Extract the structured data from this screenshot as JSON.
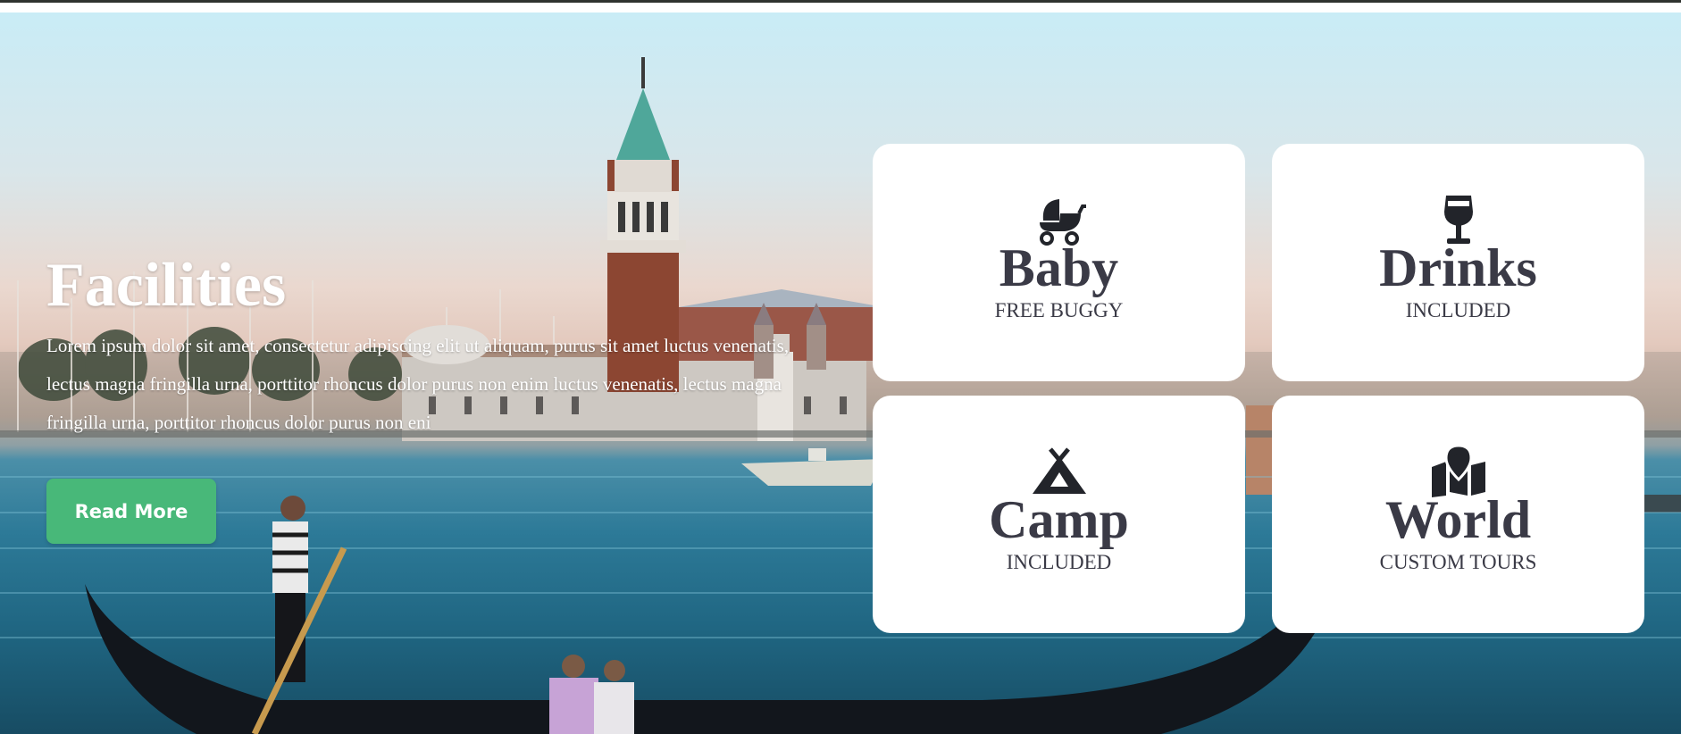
{
  "hero": {
    "title": "Facilities",
    "description": "Lorem ipsum dolor sit amet, consectetur adipiscing elit ut aliquam, purus sit amet luctus venenatis, lectus magna fringilla urna, porttitor rhoncus dolor purus non enim luctus venenatis, lectus magna fringilla urna, porttitor rhoncus dolor purus non eni",
    "button_label": "Read More"
  },
  "colors": {
    "button": "#48b879",
    "card_text": "#3a3a46",
    "card_bg": "#ffffff"
  },
  "facilities": [
    {
      "icon": "baby-carriage-icon",
      "title": "Baby",
      "subtitle": "FREE BUGGY"
    },
    {
      "icon": "wine-glass-icon",
      "title": "Drinks",
      "subtitle": "INCLUDED"
    },
    {
      "icon": "tent-icon",
      "title": "Camp",
      "subtitle": "INCLUDED"
    },
    {
      "icon": "map-location-icon",
      "title": "World",
      "subtitle": "CUSTOM TOURS"
    }
  ]
}
